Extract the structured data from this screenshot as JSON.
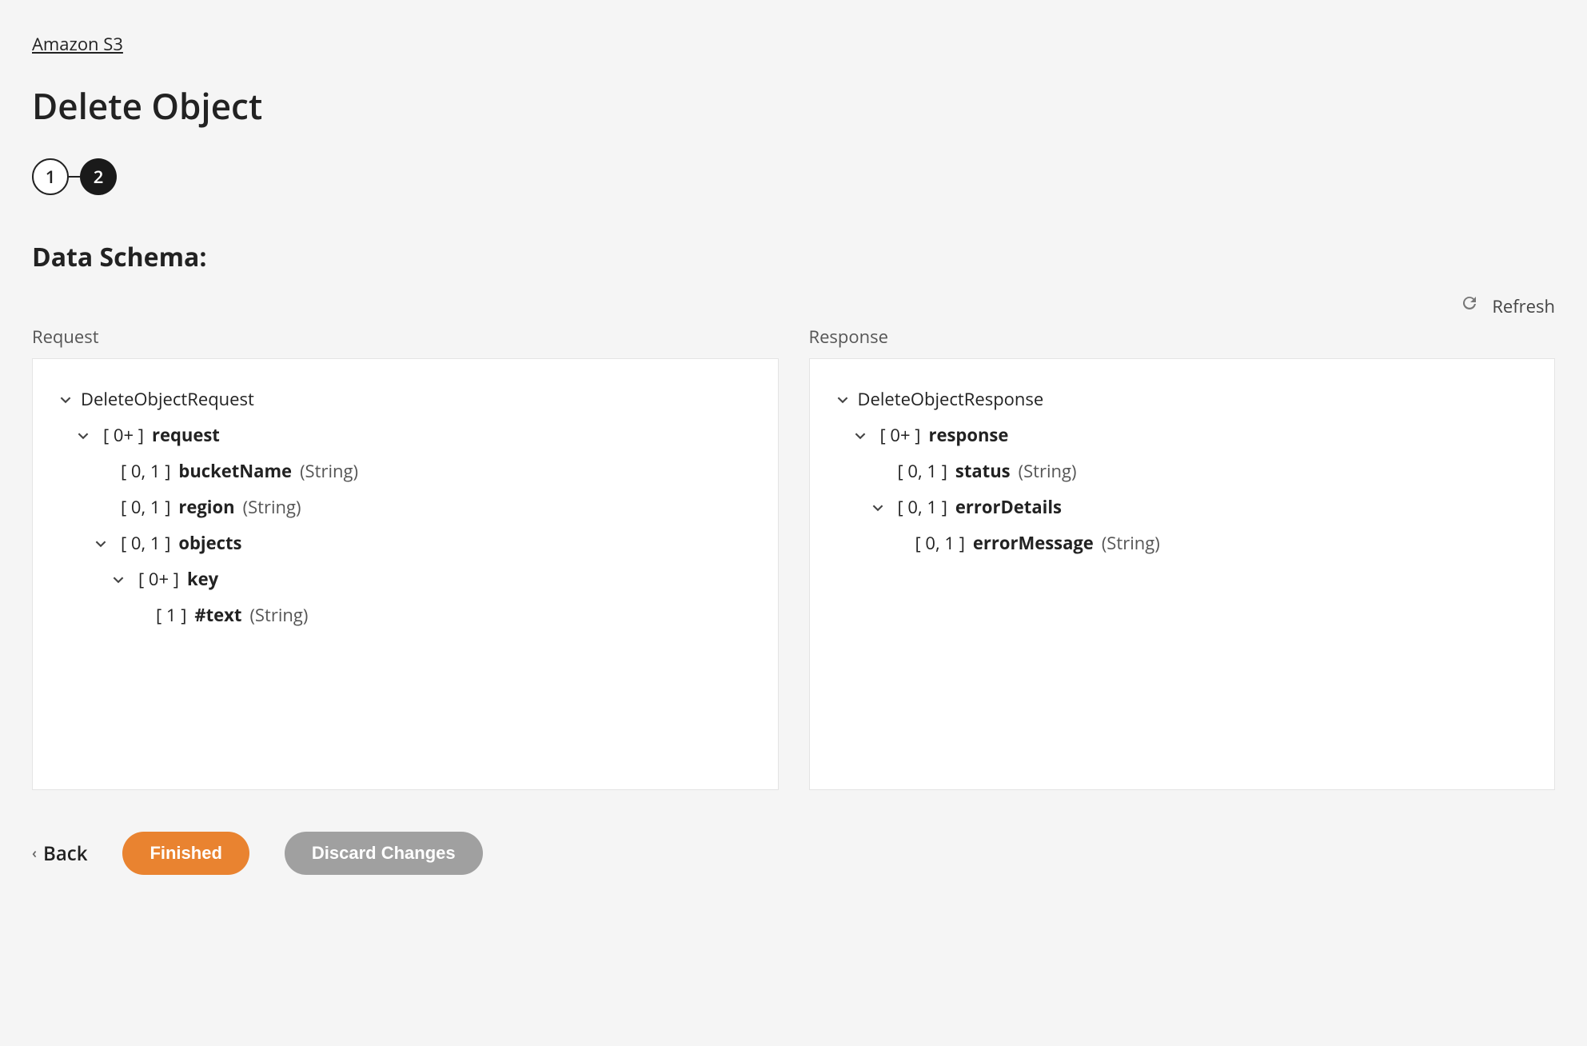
{
  "breadcrumb": "Amazon S3",
  "page_title": "Delete Object",
  "stepper": {
    "step1": "1",
    "step2": "2"
  },
  "section_title": "Data Schema:",
  "refresh_label": "Refresh",
  "panels": {
    "request_label": "Request",
    "response_label": "Response"
  },
  "request_tree": {
    "root": "DeleteObjectRequest",
    "items": [
      {
        "card": "[ 0+ ]",
        "name": "request"
      },
      {
        "card": "[ 0, 1 ]",
        "name": "bucketName",
        "type": "(String)"
      },
      {
        "card": "[ 0, 1 ]",
        "name": "region",
        "type": "(String)"
      },
      {
        "card": "[ 0, 1 ]",
        "name": "objects"
      },
      {
        "card": "[ 0+ ]",
        "name": "key"
      },
      {
        "card": "[ 1 ]",
        "name": "#text",
        "type": "(String)"
      }
    ]
  },
  "response_tree": {
    "root": "DeleteObjectResponse",
    "items": [
      {
        "card": "[ 0+ ]",
        "name": "response"
      },
      {
        "card": "[ 0, 1 ]",
        "name": "status",
        "type": "(String)"
      },
      {
        "card": "[ 0, 1 ]",
        "name": "errorDetails"
      },
      {
        "card": "[ 0, 1 ]",
        "name": "errorMessage",
        "type": "(String)"
      }
    ]
  },
  "footer": {
    "back": "Back",
    "finished": "Finished",
    "discard": "Discard Changes"
  }
}
